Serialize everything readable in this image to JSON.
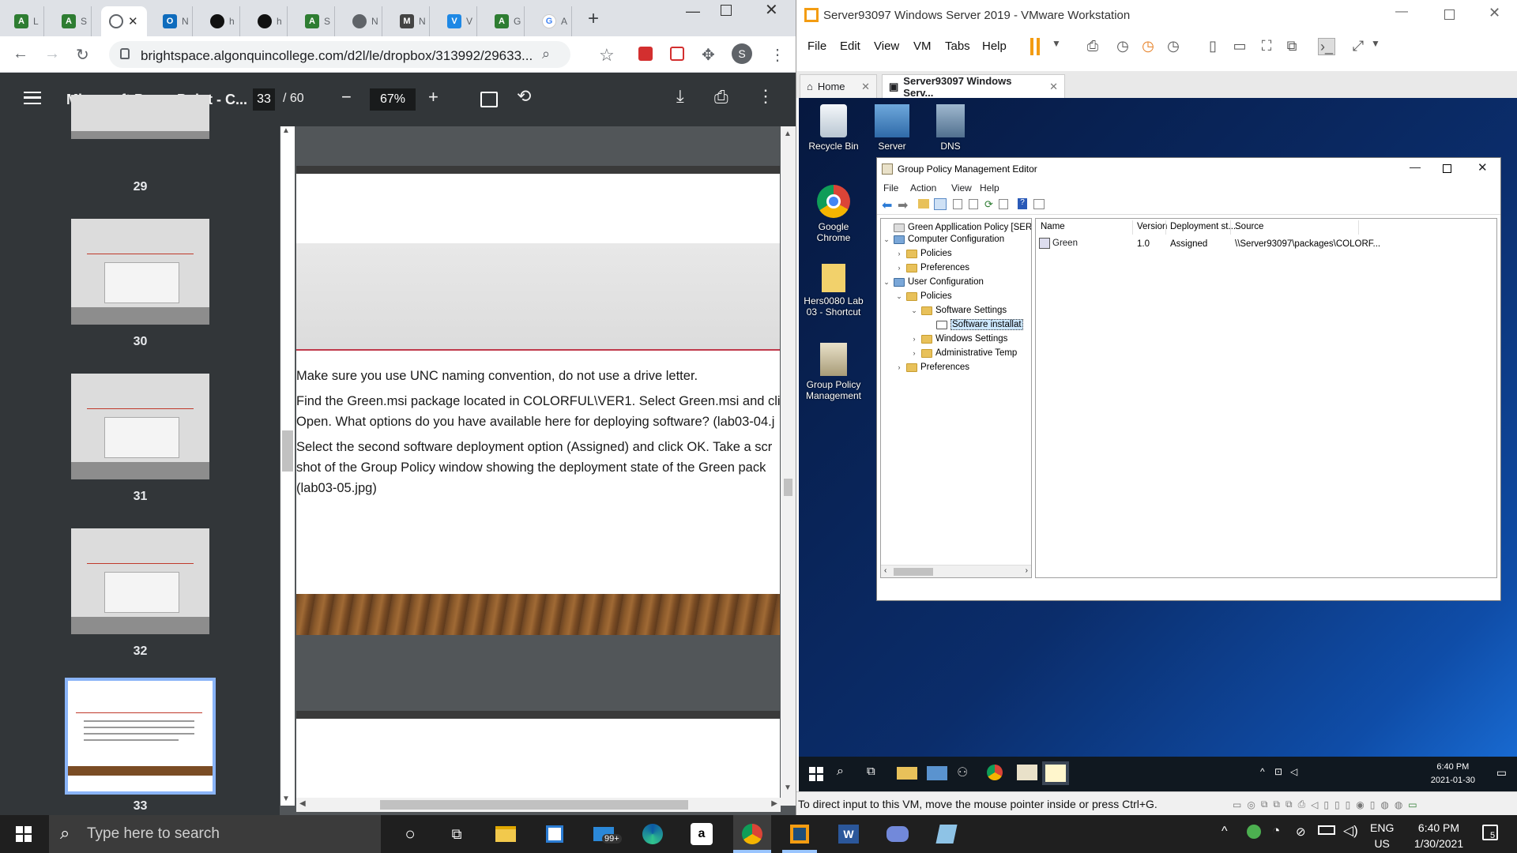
{
  "chrome": {
    "tabs": [
      {
        "label": "L",
        "icon": "acrobat-icon",
        "color": "#2e7d32"
      },
      {
        "label": "S",
        "icon": "acrobat-icon",
        "color": "#2e7d32"
      },
      {
        "label": "",
        "icon": "web-icon",
        "color": "#5f6368",
        "active": true
      },
      {
        "label": "N",
        "icon": "outlook-icon",
        "color": "#0f6cbd"
      },
      {
        "label": "h",
        "icon": "github-icon",
        "color": "#111"
      },
      {
        "label": "h",
        "icon": "github-icon",
        "color": "#111"
      },
      {
        "label": "S",
        "icon": "acrobat-icon",
        "color": "#2e7d32"
      },
      {
        "label": "N",
        "icon": "web-icon",
        "color": "#5f6368"
      },
      {
        "label": "N",
        "icon": "gmail-icon",
        "color": "#444"
      },
      {
        "label": "V",
        "icon": "vscode-icon",
        "color": "#1e88e5"
      },
      {
        "label": "G",
        "icon": "acrobat-icon",
        "color": "#2e7d32"
      },
      {
        "label": "A",
        "icon": "google-icon",
        "color": "#4285f4"
      }
    ],
    "url": "brightspace.algonquincollege.com/d2l/le/dropbox/313992/29633...",
    "profile_letter": "S"
  },
  "pdf": {
    "title": "Microsoft PowerPoint - C...",
    "page": "33",
    "of": "/ 60",
    "zoom": "67%",
    "thumbnails": [
      "29",
      "30",
      "31",
      "32",
      "33"
    ],
    "slide_text": [
      "Make sure you use UNC naming convention, do not use a drive letter.",
      "Find the Green.msi package located in COLORFUL\\VER1. Select Green.msi and cli",
      "Open. What options do you have available here for deploying software? (lab03-04.j",
      "Select the second software deployment option (Assigned) and click OK. Take a scr",
      "shot of the Group Policy window showing the deployment state of the Green pack",
      "(lab03-05.jpg)"
    ]
  },
  "vmware": {
    "title": "Server93097 Windows Server 2019 - VMware Workstation",
    "menu": [
      "File",
      "Edit",
      "View",
      "VM",
      "Tabs",
      "Help"
    ],
    "tabs": [
      {
        "label": "Home"
      },
      {
        "label": "Server93097 Windows Serv..."
      }
    ],
    "status_text": "To direct input to this VM, move the mouse pointer inside or press Ctrl+G.",
    "desktop_icons": [
      {
        "label": "Recycle Bin"
      },
      {
        "label": "Server"
      },
      {
        "label": "DNS"
      },
      {
        "label": "Google Chrome"
      },
      {
        "label": "Hers0080 Lab 03 - Shortcut"
      },
      {
        "label": "Group Policy Management"
      }
    ],
    "gpme": {
      "title": "Group Policy Management Editor",
      "menu": [
        "File",
        "Action",
        "View",
        "Help"
      ],
      "tree": [
        {
          "label": "Green Appllication Policy [SERV",
          "indent": 0,
          "ex": ""
        },
        {
          "label": "Computer Configuration",
          "indent": 0,
          "ex": "v"
        },
        {
          "label": "Policies",
          "indent": 1,
          "ex": ">"
        },
        {
          "label": "Preferences",
          "indent": 1,
          "ex": ">"
        },
        {
          "label": "User Configuration",
          "indent": 0,
          "ex": "v"
        },
        {
          "label": "Policies",
          "indent": 1,
          "ex": "v"
        },
        {
          "label": "Software Settings",
          "indent": 2,
          "ex": "v"
        },
        {
          "label": "Software installat",
          "indent": 3,
          "ex": "",
          "selected": true
        },
        {
          "label": "Windows Settings",
          "indent": 2,
          "ex": ">"
        },
        {
          "label": "Administrative Temp",
          "indent": 2,
          "ex": ">"
        },
        {
          "label": "Preferences",
          "indent": 1,
          "ex": ">"
        }
      ],
      "columns": [
        "Name",
        "Version",
        "Deployment st...",
        "Source"
      ],
      "rows": [
        {
          "name": "Green",
          "version": "1.0",
          "deployment": "Assigned",
          "source": "\\\\Server93097\\packages\\COLORF..."
        }
      ]
    },
    "guest_clock": {
      "time": "6:40 PM",
      "date": "2021-01-30"
    }
  },
  "host_taskbar": {
    "search_placeholder": "Type here to search",
    "mail_badge": "99+",
    "lang": "ENG",
    "region": "US",
    "time": "6:40 PM",
    "date": "1/30/2021",
    "notif_count": "5"
  }
}
